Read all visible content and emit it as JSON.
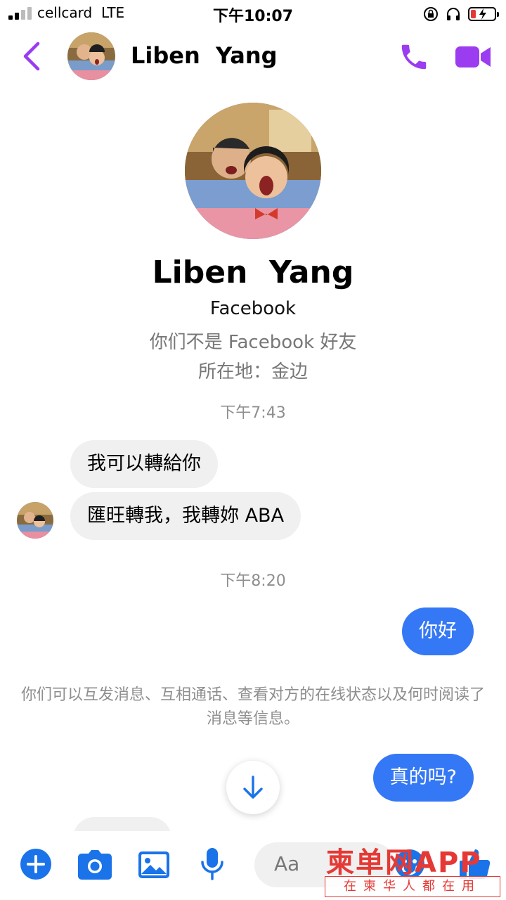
{
  "status_bar": {
    "carrier": "cellcard  LTE",
    "time": "下午10:07"
  },
  "header": {
    "contact_name": "Liben  Yang"
  },
  "profile": {
    "name": "Liben  Yang",
    "source": "Facebook",
    "friend_status": "你们不是 Facebook 好友",
    "location": "所在地：金边"
  },
  "messages": [
    {
      "time": "下午7:43"
    },
    {
      "incoming_1": "我可以轉給你",
      "incoming_2": "匯旺轉我，我轉妳 ABA"
    },
    {
      "time": "下午8:20"
    },
    {
      "outgoing_1": "你好"
    },
    {
      "notice": "你们可以互发消息、互相通话、查看对方的在线状态以及何时阅读了消息等信息。"
    },
    {
      "outgoing_2": "真的吗?"
    }
  ],
  "composer": {
    "placeholder": "Aa"
  },
  "watermark": {
    "brand": "柬单网APP",
    "tagline": "在柬华人都在用"
  },
  "colors": {
    "accent_purple": "#9b3cf0",
    "outgoing_bubble": "#3578f5",
    "incoming_bubble": "#f0f0f0",
    "composer_icons": "#1a73e8",
    "watermark_red": "#e53935"
  }
}
